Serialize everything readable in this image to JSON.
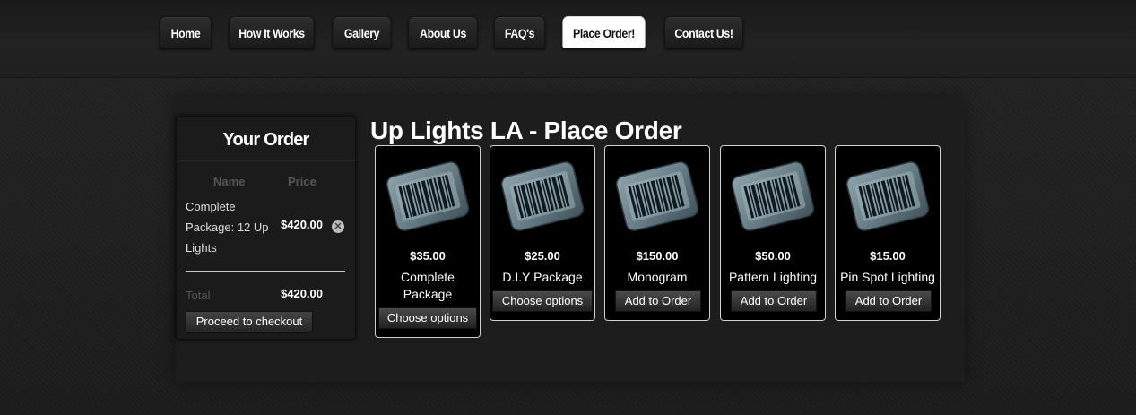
{
  "nav": {
    "items": [
      {
        "label": "Home"
      },
      {
        "label": "How It Works"
      },
      {
        "label": "Gallery"
      },
      {
        "label": "About Us"
      },
      {
        "label": "FAQ's"
      },
      {
        "label": "Place Order!",
        "active": true
      },
      {
        "label": "Contact Us!"
      }
    ]
  },
  "order": {
    "title": "Your Order",
    "col_name": "Name",
    "col_price": "Price",
    "item": {
      "name": "Complete Package: 12 Up Lights",
      "price": "$420.00",
      "remove_icon": "remove-circle-icon"
    },
    "total_label": "Total",
    "total_value": "$420.00",
    "checkout_label": "Proceed to checkout"
  },
  "main": {
    "heading": "Up Lights LA - Place Order",
    "product_icon": "barcode-icon",
    "products": [
      {
        "price": "$35.00",
        "name": "Complete Package",
        "button": "Choose options"
      },
      {
        "price": "$25.00",
        "name": "D.I.Y Package",
        "button": "Choose options"
      },
      {
        "price": "$150.00",
        "name": "Monogram",
        "button": "Add to Order"
      },
      {
        "price": "$50.00",
        "name": "Pattern Lighting",
        "button": "Add to Order"
      },
      {
        "price": "$15.00",
        "name": "Pin Spot Lighting",
        "button": "Add to Order"
      }
    ]
  },
  "colors": {
    "background": "#1e1e1e",
    "active_tab": "#ffffff",
    "card_border": "#d0d0d0",
    "barcode_tag": "#5b6f77"
  }
}
